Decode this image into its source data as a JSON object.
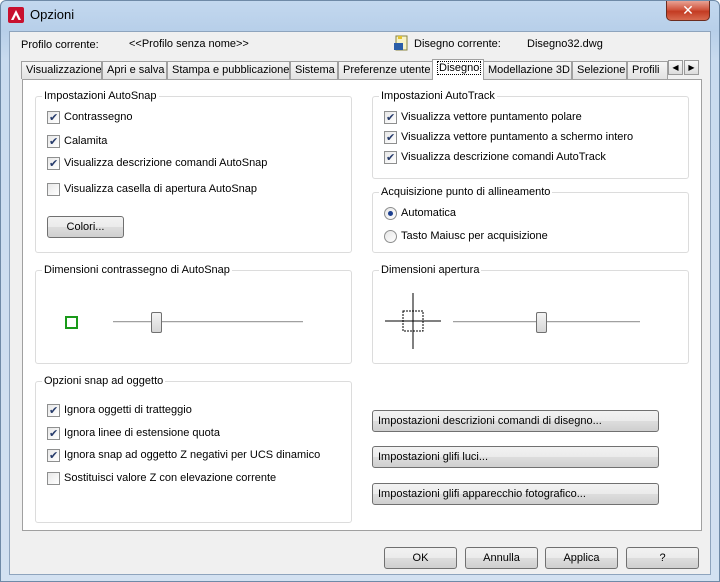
{
  "window": {
    "title": "Opzioni",
    "close_label": "✕"
  },
  "profile": {
    "current_label": "Profilo corrente:",
    "current_value": "<<Profilo senza nome>>",
    "drawing_label": "Disegno corrente:",
    "drawing_value": "Disegno32.dwg"
  },
  "tabs": [
    "Visualizzazione",
    "Apri e salva",
    "Stampa e pubblicazione",
    "Sistema",
    "Preferenze utente",
    "Disegno",
    "Modellazione 3D",
    "Selezione",
    "Profili"
  ],
  "active_tab": "Disegno",
  "autosnap": {
    "title": "Impostazioni AutoSnap",
    "items": [
      {
        "label": "Contrassegno",
        "checked": true
      },
      {
        "label": "Calamita",
        "checked": true
      },
      {
        "label": "Visualizza descrizione comandi AutoSnap",
        "checked": true
      },
      {
        "label": "Visualizza casella di apertura AutoSnap",
        "checked": false
      }
    ],
    "colors_button": "Colori..."
  },
  "autotrack": {
    "title": "Impostazioni AutoTrack",
    "items": [
      {
        "label": "Visualizza vettore puntamento polare",
        "checked": true
      },
      {
        "label": "Visualizza vettore puntamento a schermo intero",
        "checked": true
      },
      {
        "label": "Visualizza descrizione comandi AutoTrack",
        "checked": true
      }
    ]
  },
  "alignment": {
    "title": "Acquisizione punto di allineamento",
    "options": [
      {
        "label": "Automatica",
        "selected": true
      },
      {
        "label": "Tasto Maiusc per acquisizione",
        "selected": false
      }
    ]
  },
  "marker_size": {
    "title": "Dimensioni contrassegno di AutoSnap",
    "slider_fraction": 0.23,
    "marker_color": "#1a9a1a"
  },
  "aperture_size": {
    "title": "Dimensioni apertura",
    "slider_fraction": 0.47
  },
  "osnap": {
    "title": "Opzioni snap ad oggetto",
    "items": [
      {
        "label": "Ignora oggetti di tratteggio",
        "checked": true
      },
      {
        "label": "Ignora linee di estensione quota",
        "checked": true
      },
      {
        "label": "Ignora snap ad oggetto Z negativi per UCS dinamico",
        "checked": true
      },
      {
        "label": "Sostituisci valore Z con elevazione corrente",
        "checked": false
      }
    ]
  },
  "settings_buttons": {
    "tooltips": "Impostazioni descrizioni comandi di disegno...",
    "lights": "Impostazioni glifi luci...",
    "camera": "Impostazioni glifi apparecchio fotografico..."
  },
  "footer": {
    "ok": "OK",
    "cancel": "Annulla",
    "apply": "Applica",
    "help": "?"
  },
  "colors": {
    "accent_red": "#c0392b",
    "client_bg": "#f0f0f0"
  }
}
